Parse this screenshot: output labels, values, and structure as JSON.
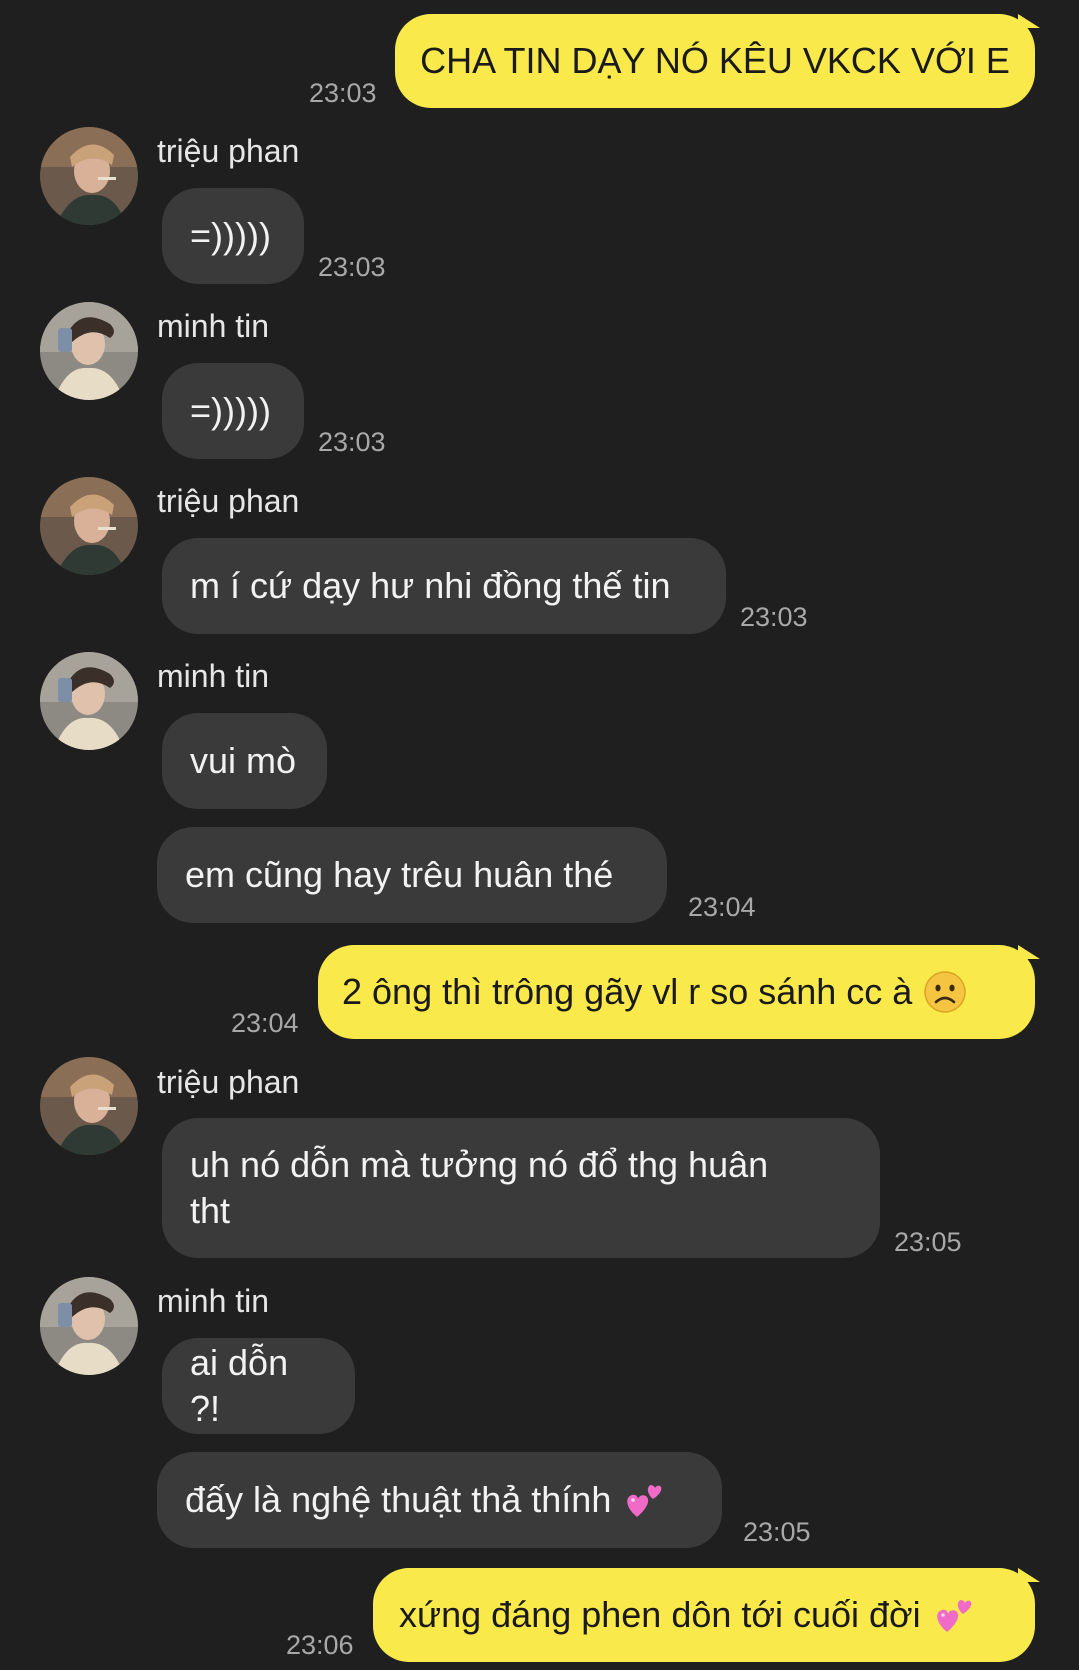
{
  "chat": {
    "senders": {
      "trieu": "triệu phan",
      "tin": "minh tin"
    },
    "messages": [
      {
        "from": "me",
        "text": "CHA TIN DẠY NÓ KÊU VKCK VỚI E",
        "time": "23:03"
      },
      {
        "from": "trieu",
        "text": "=)))))",
        "time": "23:03"
      },
      {
        "from": "tin",
        "text": "=)))))",
        "time": "23:03"
      },
      {
        "from": "trieu",
        "text": "m í cứ dạy hư nhi đồng thế tin",
        "time": "23:03"
      },
      {
        "from": "tin",
        "text": "vui mò",
        "time": ""
      },
      {
        "from": "tin",
        "text": "em cũng hay trêu huân thé",
        "time": "23:04"
      },
      {
        "from": "me",
        "text": "2 ông thì trông gãy vl r so sánh cc à",
        "emoji": "frowning-face",
        "time": "23:04"
      },
      {
        "from": "trieu",
        "text_line1": "uh nó dỗn mà tưởng nó đổ thg huân",
        "text_line2": "tht",
        "time": "23:05"
      },
      {
        "from": "tin",
        "text": "ai dỗn ?!",
        "time": ""
      },
      {
        "from": "tin",
        "text": "đấy là nghệ thuật thả thính",
        "emoji": "two-hearts",
        "time": "23:05"
      },
      {
        "from": "me",
        "text": "xứng đáng phen dôn tới cuối đời",
        "emoji": "two-hearts",
        "time": "23:06"
      }
    ]
  },
  "colors": {
    "background": "#1f1f1f",
    "incoming_bubble": "#3a3a3a",
    "outgoing_bubble": "#fae94a",
    "timestamp": "#a8a8a8"
  }
}
